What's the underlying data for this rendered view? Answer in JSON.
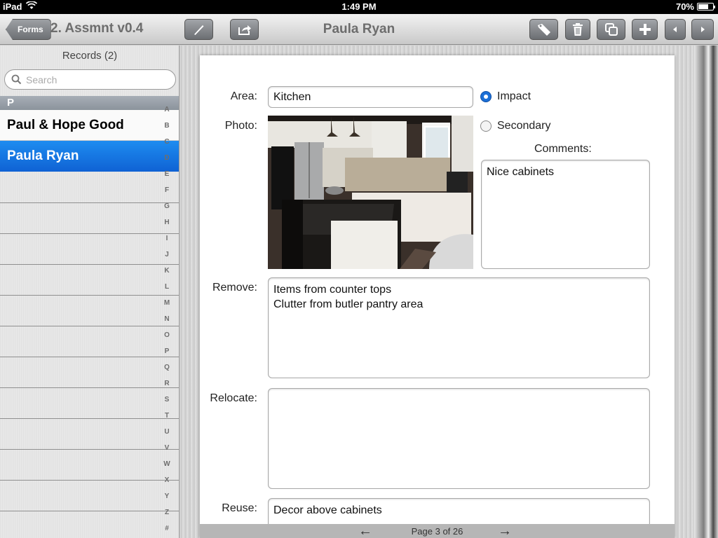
{
  "status_bar": {
    "device": "iPad",
    "time": "1:49 PM",
    "battery": "70%",
    "battery_level": 0.7
  },
  "nav": {
    "back_label": "Forms",
    "form_name": "2. Assmnt v0.4",
    "title": "Paula Ryan",
    "buttons": [
      "pen-icon",
      "share-icon",
      "tag-icon",
      "trash-icon",
      "copy-icon",
      "plus-icon",
      "arrow-left-icon",
      "arrow-right-icon"
    ]
  },
  "sidebar": {
    "title": "Records (2)",
    "search_placeholder": "Search",
    "section": "P",
    "records": [
      {
        "name": "Paul & Hope Good",
        "selected": false
      },
      {
        "name": "Paula Ryan",
        "selected": true
      }
    ],
    "index": [
      "A",
      "B",
      "C",
      "D",
      "E",
      "F",
      "G",
      "H",
      "I",
      "J",
      "K",
      "L",
      "M",
      "N",
      "O",
      "P",
      "Q",
      "R",
      "S",
      "T",
      "U",
      "V",
      "W",
      "X",
      "Y",
      "Z",
      "#"
    ]
  },
  "form": {
    "area_label": "Area:",
    "area_value": "Kitchen",
    "photo_label": "Photo:",
    "impact_label": "Impact",
    "secondary_label": "Secondary",
    "selected_option": "Impact",
    "comments_label": "Comments:",
    "comments_value": "Nice cabinets",
    "remove_label": "Remove:",
    "remove_value": "Items from counter tops\nClutter from butler pantry area",
    "relocate_label": "Relocate:",
    "relocate_value": "",
    "reuse_label": "Reuse:",
    "reuse_value": "Decor above cabinets"
  },
  "pager": {
    "text": "Page 3 of 26",
    "prev": "←",
    "next": "→"
  }
}
